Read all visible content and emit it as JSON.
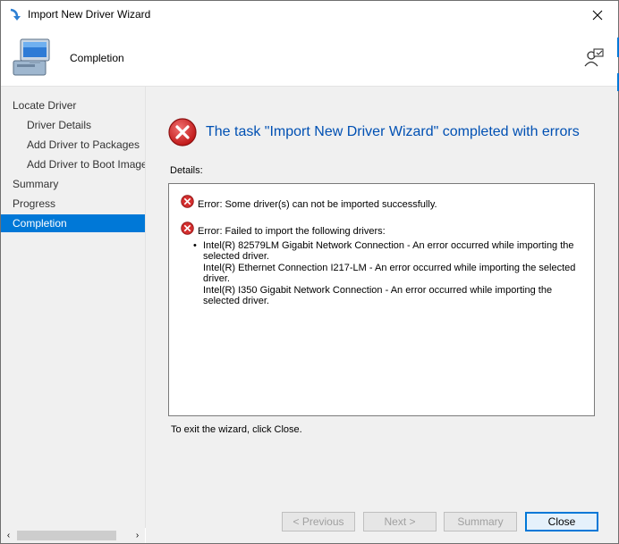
{
  "window": {
    "title": "Import New Driver Wizard",
    "close_glyph": "✕"
  },
  "banner": {
    "page_title": "Completion"
  },
  "nav": {
    "items": [
      {
        "label": "Locate Driver",
        "level": "top",
        "active": false
      },
      {
        "label": "Driver Details",
        "level": "sub",
        "active": false
      },
      {
        "label": "Add Driver to Packages",
        "level": "sub",
        "active": false
      },
      {
        "label": "Add Driver to Boot Images",
        "level": "sub",
        "active": false
      },
      {
        "label": "Summary",
        "level": "top",
        "active": false
      },
      {
        "label": "Progress",
        "level": "top",
        "active": false
      },
      {
        "label": "Completion",
        "level": "top",
        "active": true
      }
    ],
    "scroll_left_glyph": "‹",
    "scroll_right_glyph": "›"
  },
  "main": {
    "heading": "The task \"Import New Driver Wizard\" completed with errors",
    "details_label": "Details:",
    "errors": [
      {
        "text": "Error: Some driver(s) can not be imported successfully."
      },
      {
        "text": "Error: Failed to import the following drivers:"
      }
    ],
    "bullet_glyph": "•",
    "failed_drivers": [
      {
        "line1": "Intel(R) 82579LM Gigabit Network Connection - An error occurred while importing the",
        "line2": "selected driver."
      },
      {
        "line1": "Intel(R) Ethernet Connection I217-LM - An error occurred while importing the selected",
        "line2": "driver."
      },
      {
        "line1": "Intel(R) I350 Gigabit Network Connection - An error occurred while importing the",
        "line2": "selected driver."
      }
    ],
    "exit_text": "To exit the wizard, click Close."
  },
  "buttons": {
    "previous": "< Previous",
    "next": "Next >",
    "summary": "Summary",
    "close": "Close"
  },
  "colors": {
    "accent": "#0078d7",
    "heading": "#0050b3",
    "error_red": "#d32f2f"
  },
  "icons": {
    "app": "import-arrow-icon",
    "banner": "computer-icon",
    "help": "help-person-icon",
    "status": "error-icon"
  }
}
